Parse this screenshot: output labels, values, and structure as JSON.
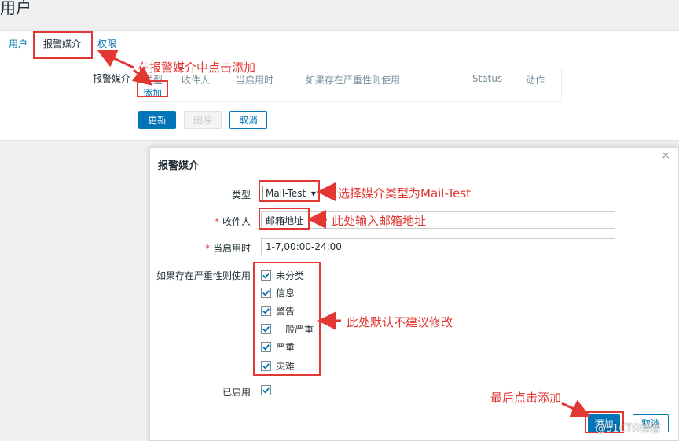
{
  "page": {
    "title": "用户"
  },
  "tabs": [
    {
      "label": "用户"
    },
    {
      "label": "报警媒介"
    },
    {
      "label": "权限"
    }
  ],
  "media_section": {
    "label": "报警媒介",
    "columns": [
      "类型",
      "收件人",
      "当启用时",
      "如果存在严重性则使用",
      "Status",
      "动作"
    ],
    "add_link": "添加"
  },
  "form_buttons": {
    "update": "更新",
    "delete": "删除",
    "cancel": "取消"
  },
  "dialog": {
    "title": "报警媒介",
    "close_glyph": "×",
    "type_label": "类型",
    "type_value": "Mail-Test",
    "sendto_label": "收件人",
    "sendto_value": "邮箱地址",
    "period_label": "当启用时",
    "period_value": "1-7,00:00-24:00",
    "severity_label": "如果存在严重性则使用",
    "severities": [
      "未分类",
      "信息",
      "警告",
      "一般严重",
      "严重",
      "灾难"
    ],
    "enabled_label": "已启用",
    "add_button": "添加",
    "cancel_button": "取消"
  },
  "annotations": {
    "step1": "在报警媒介中点击添加",
    "step2": "选择媒介类型为Mail-Test",
    "step3": "此处输入邮箱地址",
    "step4": "此处默认不建议修改",
    "step5": "最后点击添加"
  },
  "watermark": "@51CTO博客",
  "colors": {
    "link": "#0275b8",
    "annotation": "#e33734",
    "text": "#1f2c33"
  }
}
